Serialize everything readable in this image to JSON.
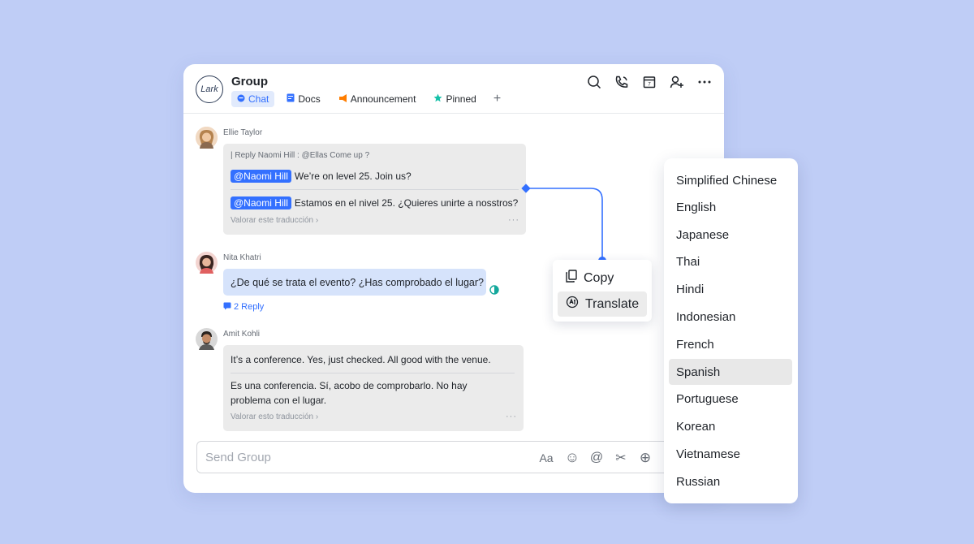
{
  "header": {
    "logo": "Lark",
    "title": "Group",
    "tabs": [
      {
        "label": "Chat"
      },
      {
        "label": "Docs"
      },
      {
        "label": "Announcement"
      },
      {
        "label": "Pinned"
      }
    ],
    "add_tab": "+"
  },
  "messages": {
    "m1": {
      "sender": "Ellie Taylor",
      "reply_quote": "| Reply Naomi Hill : @Ellas Come up ?",
      "mention": "@Naomi Hill",
      "text": "We’re on level 25. Join us?",
      "mention2": "@Naomi Hill",
      "translation": "Estamos en el nivel 25. ¿Quieres unirte a nosstros?",
      "translation_link": "Valorar este traducción ›",
      "more": "···"
    },
    "m2": {
      "sender": "Nita Khatri",
      "text": "¿De qué se trata el evento? ¿Has comprobado el lugar?",
      "reply_count": "2 Reply"
    },
    "m3": {
      "sender": "Amit Kohli",
      "text": "It’s a conference. Yes, just checked. All good with the venue.",
      "translation_line1": "Es una conferencia. Sí, acobo de comprobarlo. No hay",
      "translation_line2": "problema con el lugar.",
      "translation_link": "Valorar esto traducción ›",
      "more": "···"
    }
  },
  "input": {
    "placeholder": "Send Group",
    "font_icon": "Aa",
    "emoji_icon": "☺",
    "mention_icon": "@",
    "scissors_icon": "✂",
    "add_icon": "⊕"
  },
  "context_menu": {
    "copy": "Copy",
    "translate": "Translate"
  },
  "languages": [
    "Simplified Chinese",
    "English",
    "Japanese",
    "Thai",
    "Hindi",
    "Indonesian",
    "French",
    "Spanish",
    "Portuguese",
    "Korean",
    "Vietnamese",
    "Russian"
  ],
  "selected_language": "Spanish",
  "colors": {
    "accent": "#3370ff",
    "background": "#bfcdf6"
  }
}
